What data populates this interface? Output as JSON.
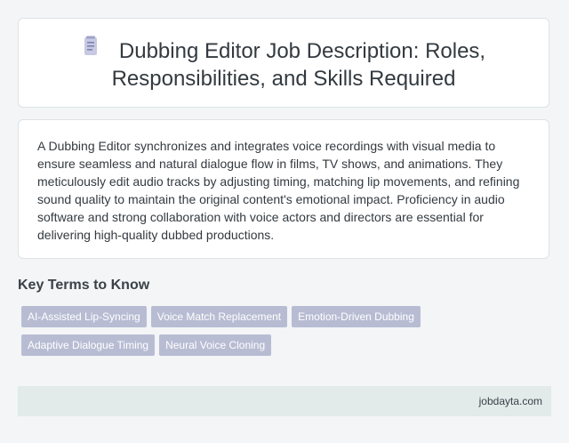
{
  "header": {
    "icon": "document-icon",
    "title": "Dubbing Editor Job Description: Roles, Responsibilities, and Skills Required"
  },
  "description": "A Dubbing Editor synchronizes and integrates voice recordings with visual media to ensure seamless and natural dialogue flow in films, TV shows, and animations. They meticulously edit audio tracks by adjusting timing, matching lip movements, and refining sound quality to maintain the original content's emotional impact. Proficiency in audio software and strong collaboration with voice actors and directors are essential for delivering high-quality dubbed productions.",
  "key_terms": {
    "heading": "Key Terms to Know",
    "tags": [
      "AI-Assisted Lip-Syncing",
      "Voice Match Replacement",
      "Emotion-Driven Dubbing",
      "Adaptive Dialogue Timing",
      "Neural Voice Cloning"
    ]
  },
  "footer": {
    "site": "jobdayta.com"
  },
  "colors": {
    "background": "#f3f5f6",
    "tag_background": "#b8bcd3",
    "footer_background": "#e3eaea",
    "text": "#333a40"
  }
}
